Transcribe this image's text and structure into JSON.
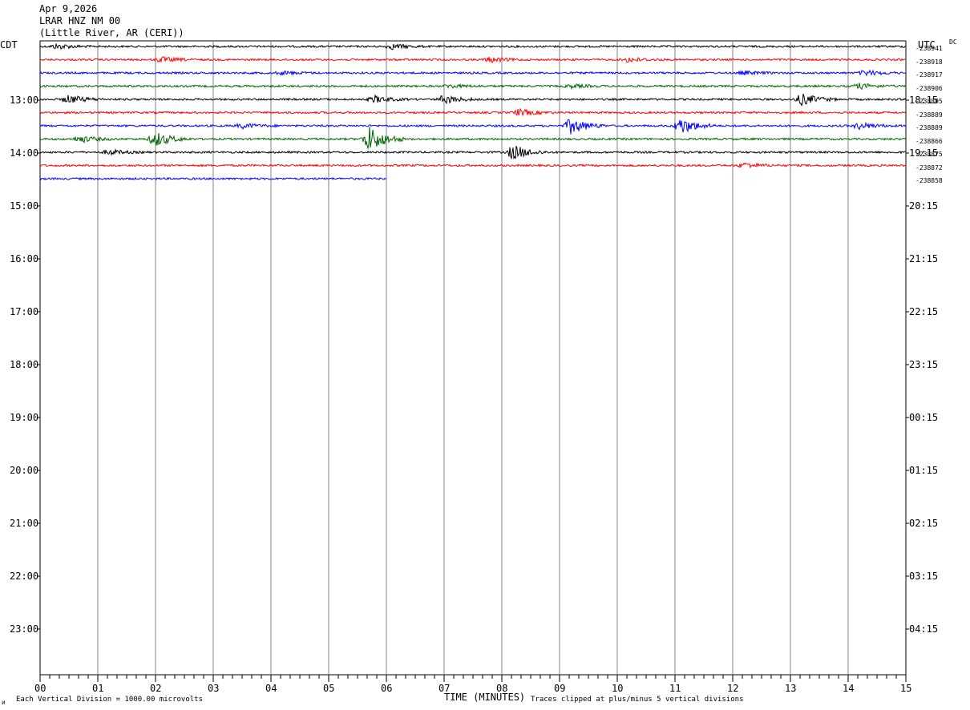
{
  "header": {
    "date": "Apr 9,2026",
    "station": "LRAR HNZ NM 00",
    "location": "(Little River, AR (CERI))"
  },
  "left_axis_label": "CDT",
  "right_axis_label": "UTC",
  "dc_label": "DC",
  "footer": {
    "left_note": "Each Vertical Division = 1000.00 microvolts",
    "center_note": "TIME (MINUTES)",
    "right_note": "Traces clipped at plus/minus 5 vertical divisions"
  },
  "chart_data": {
    "type": "line",
    "title": "",
    "xlabel": "TIME (MINUTES)",
    "ylabel": "",
    "x_range": [
      0,
      15
    ],
    "x_ticks": [
      "00",
      "01",
      "02",
      "03",
      "04",
      "05",
      "06",
      "07",
      "08",
      "09",
      "10",
      "11",
      "12",
      "13",
      "14",
      "15"
    ],
    "left_hour_labels": [
      "13:00",
      "14:00",
      "15:00",
      "16:00",
      "17:00",
      "18:00",
      "19:00",
      "20:00",
      "21:00",
      "22:00",
      "23:00"
    ],
    "right_hour_labels": [
      "18:15",
      "19:15",
      "20:15",
      "21:15",
      "22:15",
      "23:15",
      "00:15",
      "01:15",
      "02:15",
      "03:15",
      "04:15"
    ],
    "trace_colors": [
      "#000000",
      "#ff0000",
      "#0000ff",
      "#006400"
    ],
    "traces": [
      {
        "dc_offset": "-238941",
        "end_minute": 15,
        "events": [
          {
            "t": 0.3,
            "amp": 3
          },
          {
            "t": 6.1,
            "amp": 3
          }
        ]
      },
      {
        "dc_offset": "-238918",
        "end_minute": 15,
        "events": [
          {
            "t": 2.1,
            "amp": 3
          },
          {
            "t": 7.8,
            "amp": 3
          },
          {
            "t": 10.2,
            "amp": 3
          }
        ]
      },
      {
        "dc_offset": "-238917",
        "end_minute": 15,
        "events": [
          {
            "t": 4.2,
            "amp": 2
          },
          {
            "t": 12.2,
            "amp": 2
          },
          {
            "t": 14.3,
            "amp": 3
          }
        ]
      },
      {
        "dc_offset": "-238906",
        "end_minute": 15,
        "events": [
          {
            "t": 7.1,
            "amp": 2
          },
          {
            "t": 9.2,
            "amp": 2
          },
          {
            "t": 14.2,
            "amp": 3
          }
        ]
      },
      {
        "dc_offset": "-238895",
        "end_minute": 15,
        "events": [
          {
            "t": 0.5,
            "amp": 5
          },
          {
            "t": 5.8,
            "amp": 4
          },
          {
            "t": 7.0,
            "amp": 5
          },
          {
            "t": 13.2,
            "amp": 7
          }
        ]
      },
      {
        "dc_offset": "-238889",
        "end_minute": 15,
        "events": [
          {
            "t": 8.3,
            "amp": 4
          }
        ]
      },
      {
        "dc_offset": "-238889",
        "end_minute": 15,
        "events": [
          {
            "t": 3.5,
            "amp": 3
          },
          {
            "t": 9.2,
            "amp": 10
          },
          {
            "t": 11.1,
            "amp": 10
          },
          {
            "t": 14.2,
            "amp": 4
          }
        ]
      },
      {
        "dc_offset": "-238866",
        "end_minute": 15,
        "events": [
          {
            "t": 0.7,
            "amp": 4
          },
          {
            "t": 2.0,
            "amp": 9
          },
          {
            "t": 5.7,
            "amp": 16
          }
        ]
      },
      {
        "dc_offset": "-238875",
        "end_minute": 15,
        "events": [
          {
            "t": 1.2,
            "amp": 3
          },
          {
            "t": 8.2,
            "amp": 9
          }
        ]
      },
      {
        "dc_offset": "-238872",
        "end_minute": 15,
        "events": [
          {
            "t": 12.2,
            "amp": 3
          }
        ]
      },
      {
        "dc_offset": "-238858",
        "end_minute": 6,
        "events": []
      }
    ],
    "grid": true,
    "legend": "none"
  }
}
